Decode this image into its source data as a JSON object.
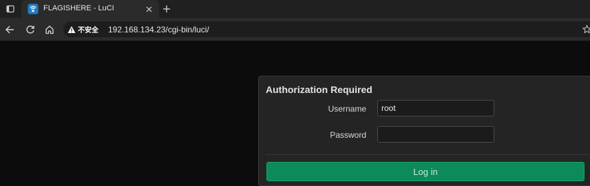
{
  "browser": {
    "tab": {
      "title": "FLAGISHERE - LuCI",
      "favicon": "openwrt-favicon-icon"
    },
    "address_bar": {
      "security_label": "不安全",
      "url": "192.168.134.23/cgi-bin/luci/"
    },
    "icons": {
      "tab_actions": "tab-actions-icon",
      "close": "close-icon",
      "new_tab": "plus-icon",
      "back": "back-arrow-icon",
      "refresh": "refresh-icon",
      "home": "home-icon",
      "warning": "warning-triangle-icon",
      "favorite": "star-icon"
    }
  },
  "login": {
    "title": "Authorization Required",
    "username_label": "Username",
    "username_value": "root",
    "password_label": "Password",
    "password_value": "",
    "submit_label": "Log in"
  },
  "colors": {
    "page_background": "#0c0c0c",
    "panel_background": "#242424",
    "button_green": "#0d8a5a",
    "tab_active": "#2b2b2b",
    "tabbar": "#202020"
  }
}
